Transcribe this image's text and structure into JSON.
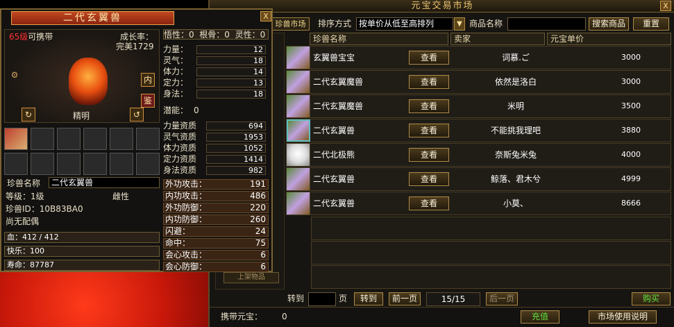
{
  "market": {
    "title": "元宝交易市场",
    "close": "X",
    "tab_label": "珍兽市场",
    "sort_label": "排序方式",
    "sort_value": "按单价从低至高排列",
    "product_name_label": "商品名称",
    "product_name_value": "",
    "search_button": "搜索商品",
    "reset_button": "重置",
    "columns": [
      "珍兽名称",
      "卖家",
      "元宝单价"
    ],
    "view_label": "查看",
    "listings": [
      {
        "name": "玄翼兽宝宝",
        "seller": "词慕.ご",
        "price": "3000"
      },
      {
        "name": "二代玄翼魔兽",
        "seller": "依然是洛白",
        "price": "3000"
      },
      {
        "name": "二代玄翼魔兽",
        "seller": "米明",
        "price": "3500"
      },
      {
        "name": "二代玄翼兽",
        "seller": "不能挑我理吧",
        "price": "3880"
      },
      {
        "name": "二代北极熊",
        "seller": "奈斯兔米兔",
        "price": "4000"
      },
      {
        "name": "二代玄翼兽",
        "seller": "鲸落、君木兮",
        "price": "4999"
      },
      {
        "name": "二代玄翼兽",
        "seller": "小莫、",
        "price": "8666"
      }
    ],
    "left_button": "上架物品",
    "goto_label": "转到",
    "page_unit": "页",
    "goto_button": "转到",
    "prev_button": "前一页",
    "page_indicator": "15/15",
    "next_button": "后一页",
    "buy_button": "购买",
    "yuanbao_label": "携带元宝：",
    "yuanbao_value": "0",
    "recharge_button": "充值",
    "help_button": "市场使用说明"
  },
  "pet": {
    "title": "二代玄翼兽",
    "close": "X",
    "level_req": "65级",
    "carry_label": "可携带",
    "growth_label": "成长率：",
    "growth_value": "完美1729",
    "nei_button": "内",
    "jian_button": "鉴",
    "personality": "精明",
    "name_label": "珍兽名称",
    "name_value": "二代玄翼兽",
    "grade": "等级：1级",
    "gender": "雌性",
    "id": "珍兽ID：10B83BA0",
    "spouse": "尚无配偶",
    "hp": "血：412 / 412",
    "happiness": "快乐：100",
    "lifespan": "寿命：87787",
    "wuxing": "悟性：0",
    "genggu": "根骨：0",
    "lingxing": "灵性：0",
    "attrs": [
      {
        "label": "力量：",
        "value": "12"
      },
      {
        "label": "灵气：",
        "value": "18"
      },
      {
        "label": "体力：",
        "value": "14"
      },
      {
        "label": "定力：",
        "value": "13"
      },
      {
        "label": "身法：",
        "value": "18"
      }
    ],
    "potential_label": "潜能：",
    "potential_value": "0",
    "aptitudes": [
      {
        "label": "力量资质",
        "value": "694"
      },
      {
        "label": "灵气资质",
        "value": "1953"
      },
      {
        "label": "体力资质",
        "value": "1052"
      },
      {
        "label": "定力资质",
        "value": "1414"
      },
      {
        "label": "身法资质",
        "value": "982"
      }
    ],
    "combat": [
      {
        "label": "外功攻击：",
        "value": "191"
      },
      {
        "label": "内功攻击：",
        "value": "486"
      },
      {
        "label": "外功防御：",
        "value": "220"
      },
      {
        "label": "内功防御：",
        "value": "260"
      },
      {
        "label": "闪避：",
        "value": "24"
      },
      {
        "label": "命中：",
        "value": "75"
      },
      {
        "label": "会心攻击：",
        "value": "6"
      },
      {
        "label": "会心防御：",
        "value": "6"
      }
    ]
  }
}
